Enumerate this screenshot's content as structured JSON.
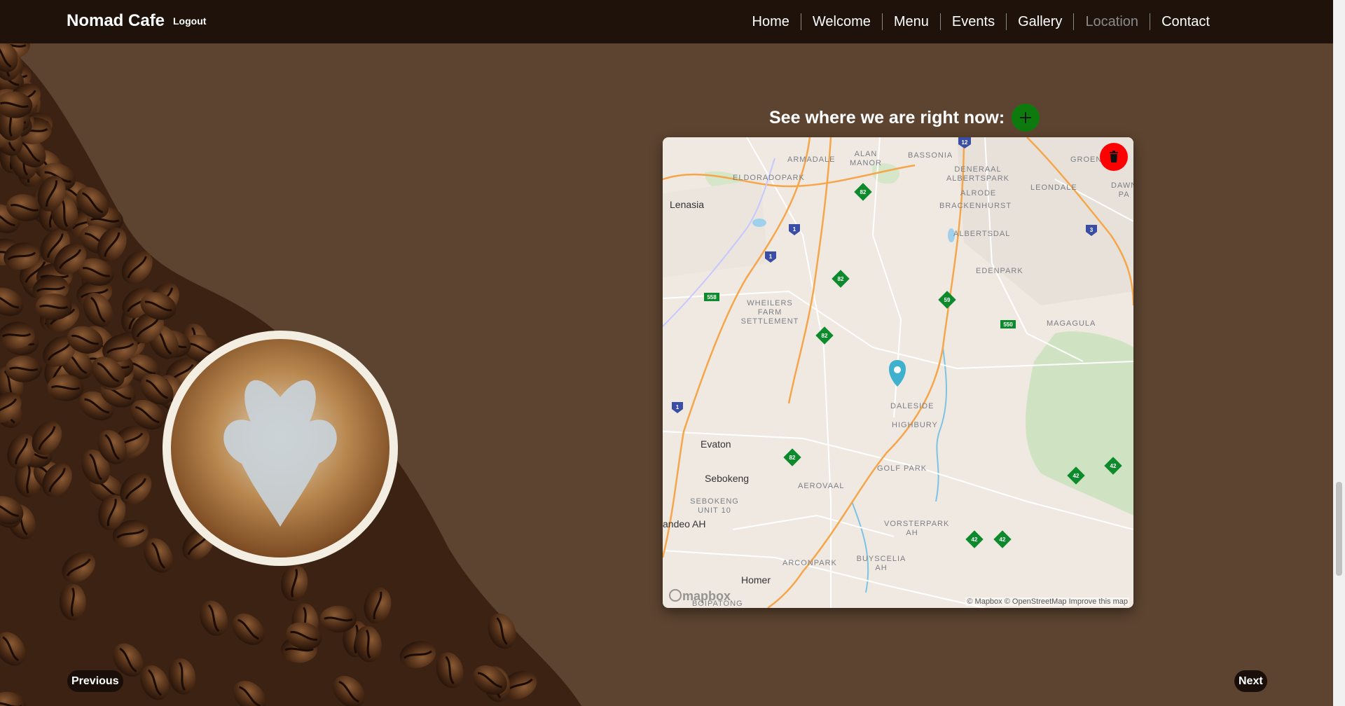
{
  "navbar": {
    "brand": "Nomad Cafe",
    "logout": "Logout",
    "links": [
      {
        "label": "Home",
        "active": false
      },
      {
        "label": "Welcome",
        "active": false
      },
      {
        "label": "Menu",
        "active": false
      },
      {
        "label": "Events",
        "active": false
      },
      {
        "label": "Gallery",
        "active": false
      },
      {
        "label": "Location",
        "active": true
      },
      {
        "label": "Contact",
        "active": false
      }
    ]
  },
  "location": {
    "title": "See where we are right now:",
    "add_icon": "plus-icon",
    "delete_icon": "trash-icon",
    "map": {
      "marker_icon": "map-pin-icon",
      "logo": "mapbox",
      "attribution": {
        "mapbox": "© Mapbox",
        "osm": "© OpenStreetMap",
        "improve": "Improve this map"
      },
      "labels": {
        "armadale": "ARMADALE",
        "alan_manor": "ALAN MANOR",
        "bassonia": "BASSONIA",
        "deneraal": "DENERAAL ALBERTSPARK",
        "groen": "GROEN",
        "alrode": "ALRODE",
        "leondale": "LEONDALE",
        "dawn_park": "DAWN PA",
        "eldoradopark": "ELDORADOPARK",
        "brackenhurst": "BRACKENHURST",
        "lenasia": "Lenasia",
        "albertsdal": "ALBERTSDAL",
        "edenpark": "EDENPARK",
        "wheilers": "WHEILERS FARM SETTLEMENT",
        "magagula": "MAGAGULA",
        "daleside": "DALESIDE",
        "highbury": "HIGHBURY",
        "evaton": "Evaton",
        "golf_park": "GOLF PARK",
        "sebokeng": "Sebokeng",
        "aerovaal": "AEROVAAL",
        "sebokeng_unit": "SEBOKENG UNIT 10",
        "andeo": "andeo AH",
        "vorsterpark": "VORSTERPARK AH",
        "arconpark": "ARCONPARK",
        "buyscelia": "BUYSCELIA AH",
        "homer": "Homer",
        "boipatong": "BOIPATONG"
      },
      "shields": {
        "r82": "82",
        "r59": "59",
        "r558": "558",
        "r550": "550",
        "r42": "42",
        "n1": "1",
        "n3": "3",
        "n12": "12"
      }
    }
  },
  "pager": {
    "previous": "Previous",
    "next": "Next"
  }
}
